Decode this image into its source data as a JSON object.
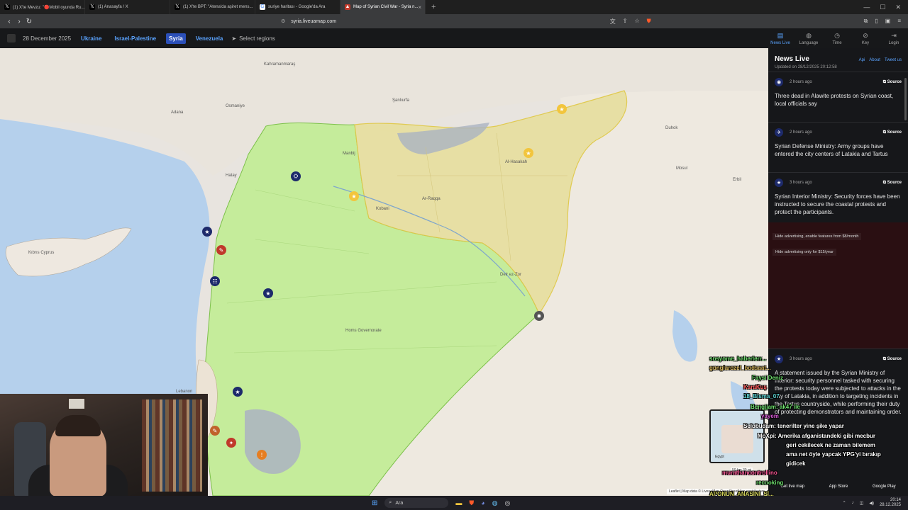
{
  "browser": {
    "tabs": [
      {
        "label": "(1) X'te Mevzu: \"🔴Mobil oyunda Ru...",
        "icon": "x"
      },
      {
        "label": "(1) Anasayfa / X",
        "icon": "x"
      },
      {
        "label": "(1) X'te BPT: \"Atena'da aşiret mens...",
        "icon": "x"
      },
      {
        "label": "suriye haritası - Google'da Ara",
        "icon": "google"
      },
      {
        "label": "Map of Syrian Civil War - Syria n...",
        "icon": "map",
        "active": true
      }
    ],
    "url": "syria.liveuamap.com"
  },
  "site": {
    "date": "28 December 2025",
    "regions": [
      "Ukraine",
      "Israel-Palestine",
      "Syria",
      "Venezuela"
    ],
    "active_region": "Syria",
    "select_regions": "Select regions",
    "nav": [
      {
        "label": "News Live",
        "icon": "news-icon",
        "active": true
      },
      {
        "label": "Language",
        "icon": "globe-icon"
      },
      {
        "label": "Time",
        "icon": "clock-icon"
      },
      {
        "label": "Key",
        "icon": "key-icon"
      },
      {
        "label": "Login",
        "icon": "login-icon"
      }
    ]
  },
  "map": {
    "labels": {
      "kahramanmaras": "Kahramanmaraş",
      "sanliurfa": "Şanlıurfa",
      "osmaniye": "Osmaniye",
      "adana": "Adana",
      "hatay": "Hatay",
      "cyprus": "Kıbrıs\nCyprus",
      "lebanon": "Lebanon",
      "mosul": "Mosul",
      "erbil": "Erbil",
      "duhok": "Duhok",
      "raqqa": "Ar-Raqqa",
      "hassakeh": "Al-Hasakah",
      "homs": "Homs Governorate",
      "deir": "Deir ez-Zor",
      "manbij": "Manbij",
      "kobani": "Kobani"
    },
    "attribution": "Leaflet | Map data © LiveuaMap OpenStreetMap contributors",
    "minimap_label": "Egypt",
    "scale": "50 km\n30 mi"
  },
  "news": {
    "title": "News Live",
    "links": [
      "Api",
      "About",
      "Tweet us"
    ],
    "updated": "Updated on 28/12/2025 20:12:58",
    "items": [
      {
        "time": "2 hours ago",
        "source": "Source",
        "text": "Three dead in Alawite protests on Syrian coast, local officials say"
      },
      {
        "time": "2 hours ago",
        "source": "Source",
        "text": "Syrian Defense Ministry: Army groups have entered the city centers of Latakia and Tartus"
      },
      {
        "time": "3 hours ago",
        "source": "Source",
        "text": "Syrian Interior Ministry: Security forces have been instructed to secure the coastal protests and protect the participants."
      }
    ],
    "ad": [
      "Hide advertising, enable features from $8/month",
      "Hide advertising only for $15/year"
    ],
    "long_item": {
      "time": "3 hours ago",
      "source": "Source",
      "text": "A statement issued by the Syrian Ministry of Interior: security personnel tasked with securing the protests today were subjected to attacks in the city of Latakia, in addition to targeting incidents in the Tartus countryside, while performing their duty of protecting demonstrators and maintaining order."
    },
    "stores": [
      "Get live map",
      "App Store",
      "Google Play"
    ]
  },
  "chat": [
    {
      "text": "sosyome_haberlerr...",
      "color": "#6fe06f"
    },
    {
      "text": "gonglarozel_bodsaat...",
      "color": "#d4b35a"
    },
    {
      "text": "Faysi Deniz",
      "color": "#6fe06f"
    },
    {
      "text": "KaraKuş",
      "color": "#ff5a5a"
    },
    {
      "text": "18_Bisma_07",
      "color": "#5ad4d4"
    },
    {
      "text": "Bengjjam: ak47 ile",
      "color": "#6fe06f"
    },
    {
      "text": "yayem",
      "color": "#d45ad4"
    },
    {
      "text": "Selobudam: tenerilter yine şike yapar",
      "color": "#5a8cff"
    },
    {
      "text": "MoXpi: Amerika afganistandeki gibi mecbur",
      "color": "#ff8c3a"
    },
    {
      "text": "geri cekilecek ne zaman bilemem",
      "color": "#ffffff"
    },
    {
      "text": "ama net öyle yapcak YPG'yi bırakıp",
      "color": "#ffffff"
    },
    {
      "text": "gidicek",
      "color": "#ffffff"
    },
    {
      "text": "murathancontrollino",
      "color": "#ff5a9a"
    },
    {
      "text": "recooking",
      "color": "#6fe06f"
    },
    {
      "text": "APONUN_ANASINI_Sİ...",
      "color": "#d4d45a"
    }
  ],
  "taskbar": {
    "search": "Ara",
    "time": "20:14",
    "date": "28.12.2025"
  },
  "colors": {
    "gov_green": "#c5ec9b",
    "sdf_yellow": "#e7dfa1",
    "israel_gray": "#aab3c2",
    "sea": "#b5d0ec",
    "accent": "#5aa3ff"
  }
}
